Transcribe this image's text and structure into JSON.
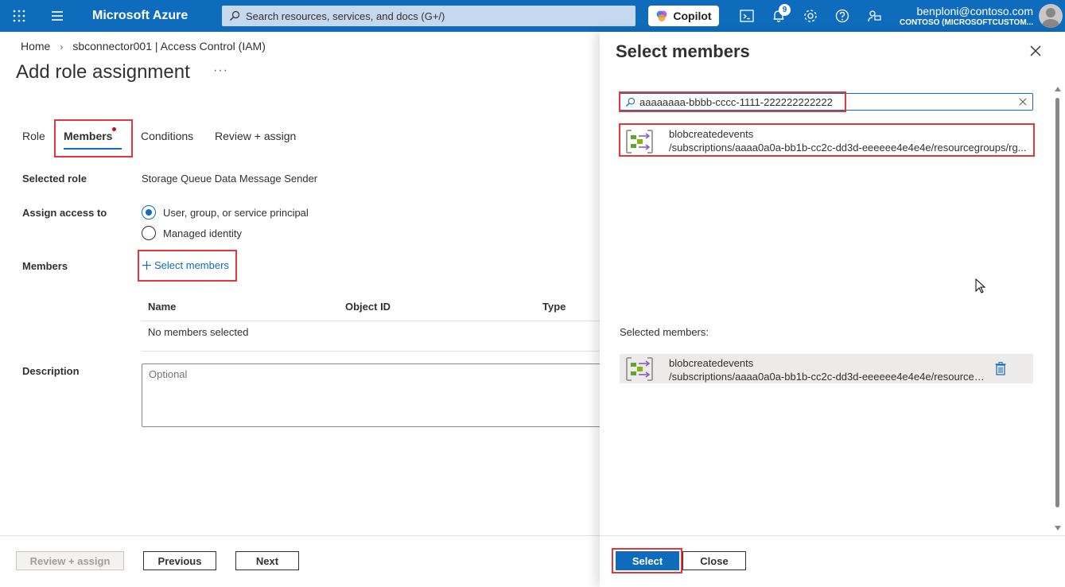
{
  "topbar": {
    "brand": "Microsoft Azure",
    "search_placeholder": "Search resources, services, and docs (G+/)",
    "copilot_label": "Copilot",
    "notification_count": "9",
    "user_email": "benploni@contoso.com",
    "user_tenant": "CONTOSO (MICROSOFTCUSTOM...",
    "icons": [
      "waffle-icon",
      "hamburger-icon",
      "search-icon",
      "cloud-shell-icon",
      "bell-icon",
      "gear-icon",
      "help-icon",
      "feedback-icon",
      "avatar"
    ]
  },
  "breadcrumb": {
    "home": "Home",
    "resource": "sbconnector001 | Access Control (IAM)"
  },
  "page": {
    "title": "Add role assignment",
    "more": "···"
  },
  "tabs": [
    "Role",
    "Members",
    "Conditions",
    "Review + assign"
  ],
  "form": {
    "selected_role_label": "Selected role",
    "selected_role_value": "Storage Queue Data Message Sender",
    "assign_access_label": "Assign access to",
    "option_1": "User, group, or service principal",
    "option_2": "Managed identity",
    "members_label": "Members",
    "select_members_link": "Select members",
    "table_headers": [
      "Name",
      "Object ID",
      "Type"
    ],
    "table_empty": "No members selected",
    "description_label": "Description",
    "description_placeholder": "Optional"
  },
  "footer": {
    "review_assign": "Review + assign",
    "previous": "Previous",
    "next": "Next"
  },
  "panel": {
    "title": "Select members",
    "search_value": "aaaaaaaa-bbbb-cccc-1111-222222222222",
    "result": {
      "name": "blobcreatedevents",
      "path": "/subscriptions/aaaa0a0a-bb1b-cc2c-dd3d-eeeeee4e4e4e/resourcegroups/rg..."
    },
    "selected_label": "Selected members:",
    "selected_item": {
      "name": "blobcreatedevents",
      "path": "/subscriptions/aaaa0a0a-bb1b-cc2c-dd3d-eeeeee4e4e4e/resourceg..."
    },
    "select_button": "Select",
    "close_button": "Close"
  },
  "colors": {
    "accent": "#0f6cbd",
    "highlight": "#e0383e",
    "text": "#323130"
  }
}
